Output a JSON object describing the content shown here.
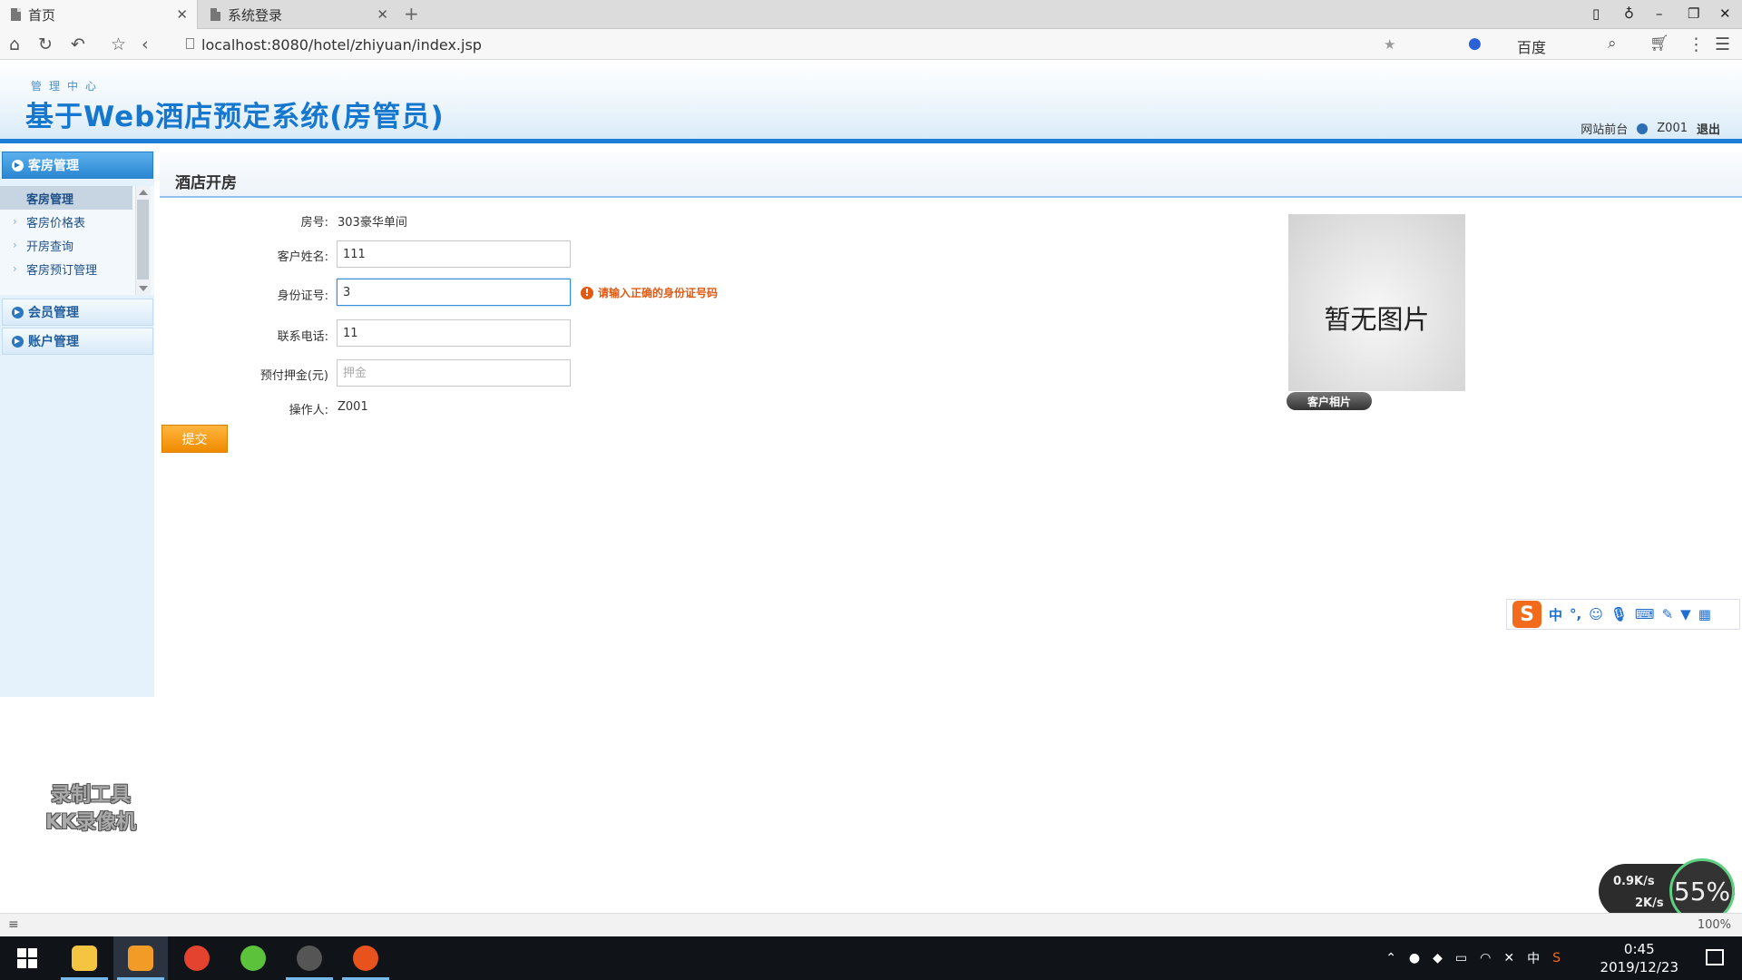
{
  "browser": {
    "tabs": [
      {
        "label": "首页",
        "active": true
      },
      {
        "label": "系统登录",
        "active": false
      }
    ],
    "url": "localhost:8080/hotel/zhiyuan/index.jsp",
    "search_engine": "百度"
  },
  "header": {
    "sub_title": "管理中心",
    "title": "基于Web酒店预定系统(房管员)",
    "links": {
      "front": "网站前台",
      "user": "Z001",
      "logout": "退出"
    }
  },
  "sidebar": {
    "groups": [
      {
        "label": "客房管理"
      },
      {
        "label": "会员管理"
      },
      {
        "label": "账户管理"
      }
    ],
    "sub_items": [
      {
        "label": "客房管理"
      },
      {
        "label": "客房价格表"
      },
      {
        "label": "开房查询"
      },
      {
        "label": "客房预订管理"
      }
    ]
  },
  "main": {
    "title": "酒店开房",
    "form": {
      "room_label": "房号:",
      "room_value": "303豪华单间",
      "name_label": "客户姓名:",
      "name_value": "111",
      "id_label": "身份证号:",
      "id_value": "3",
      "id_error": "请输入正确的身份证号码",
      "phone_label": "联系电话:",
      "phone_value": "11",
      "deposit_label": "预付押金(元)",
      "deposit_placeholder": "押金",
      "operator_label": "操作人:",
      "operator_value": "Z001",
      "submit_label": "提交"
    },
    "photo": {
      "placeholder_text": "暂无图片",
      "button_label": "客户相片"
    }
  },
  "ime": {
    "logo": "S",
    "mode": "中",
    "punct": "°,"
  },
  "watermark": {
    "line1": "录制工具",
    "line2": "KK录像机"
  },
  "netmon": {
    "up": "0.9K/s",
    "down": "2K/s",
    "percent": "55%"
  },
  "statusbar": {
    "zoom": "100%"
  },
  "taskbar": {
    "ime_lang": "中",
    "time": "0:45",
    "date": "2019/12/23"
  },
  "colors": {
    "brand_blue": "#1677cf",
    "accent_orange": "#f08b00",
    "error_orange": "#e05a13"
  }
}
